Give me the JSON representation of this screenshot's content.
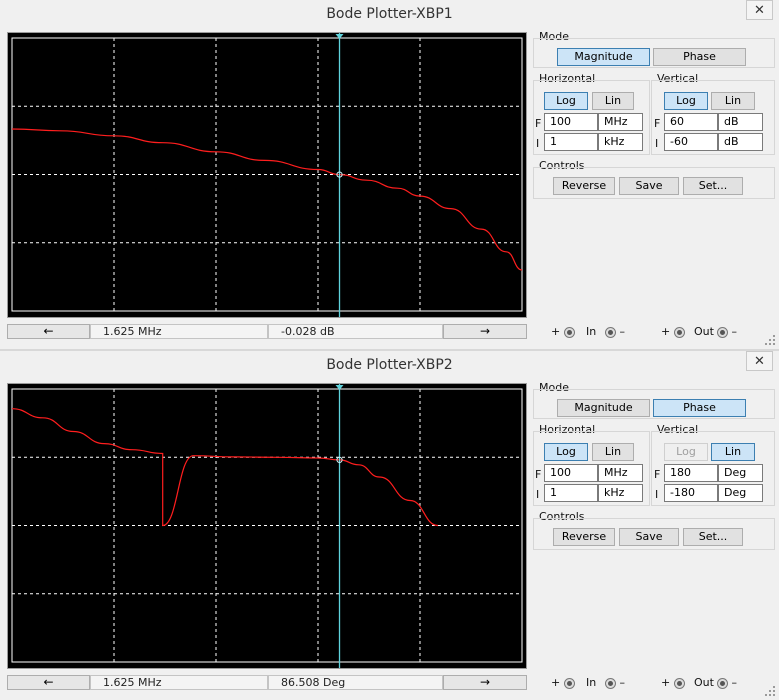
{
  "plotters": [
    {
      "title": "Bode Plotter-XBP1",
      "close_glyph": "✕",
      "mode_label": "Mode",
      "mode_buttons": [
        "Magnitude",
        "Phase"
      ],
      "mode_selected": "Magnitude",
      "horizontal": {
        "label": "Horizontal",
        "scale_buttons": [
          "Log",
          "Lin"
        ],
        "scale_selected": "Log",
        "F": {
          "prefix": "F",
          "value": "100",
          "unit": "MHz"
        },
        "I": {
          "prefix": "I",
          "value": "1",
          "unit": "kHz"
        }
      },
      "vertical": {
        "label": "Vertical",
        "scale_buttons": [
          "Log",
          "Lin"
        ],
        "scale_selected": "Log",
        "log_disabled": false,
        "F": {
          "prefix": "F",
          "value": "60",
          "unit": "dB"
        },
        "I": {
          "prefix": "I",
          "value": "-60",
          "unit": "dB"
        }
      },
      "controls": {
        "label": "Controls",
        "buttons": [
          "Reverse",
          "Save",
          "Set..."
        ]
      },
      "cursor": {
        "left_arrow": "←",
        "right_arrow": "→",
        "frequency": "1.625 MHz",
        "reading": "-0.028 dB"
      },
      "terminals": {
        "in": "In",
        "out": "Out",
        "plus": "+",
        "minus": "–"
      },
      "chart_data": {
        "type": "line",
        "x_scale": "log",
        "x_range_hz": [
          1000,
          100000000
        ],
        "y_range": [
          -60,
          60
        ],
        "y_unit": "dB",
        "cursor_x_hz": 1625000,
        "cursor_y": -0.028,
        "points": [
          [
            1000,
            20
          ],
          [
            3000,
            19.2
          ],
          [
            10000,
            17
          ],
          [
            30000,
            14
          ],
          [
            100000,
            10
          ],
          [
            300000,
            6.2
          ],
          [
            1000000,
            2.2
          ],
          [
            1625000,
            -0.03
          ],
          [
            3000000,
            -2.5
          ],
          [
            6000000,
            -6
          ],
          [
            10000000,
            -9.5
          ],
          [
            20000000,
            -15
          ],
          [
            40000000,
            -24
          ],
          [
            70000000,
            -34
          ],
          [
            100000000,
            -42
          ]
        ],
        "grid": true
      }
    },
    {
      "title": "Bode Plotter-XBP2",
      "close_glyph": "✕",
      "mode_label": "Mode",
      "mode_buttons": [
        "Magnitude",
        "Phase"
      ],
      "mode_selected": "Phase",
      "horizontal": {
        "label": "Horizontal",
        "scale_buttons": [
          "Log",
          "Lin"
        ],
        "scale_selected": "Log",
        "F": {
          "prefix": "F",
          "value": "100",
          "unit": "MHz"
        },
        "I": {
          "prefix": "I",
          "value": "1",
          "unit": "kHz"
        }
      },
      "vertical": {
        "label": "Vertical",
        "scale_buttons": [
          "Log",
          "Lin"
        ],
        "scale_selected": "Lin",
        "log_disabled": true,
        "F": {
          "prefix": "F",
          "value": "180",
          "unit": "Deg"
        },
        "I": {
          "prefix": "I",
          "value": "-180",
          "unit": "Deg"
        }
      },
      "controls": {
        "label": "Controls",
        "buttons": [
          "Reverse",
          "Save",
          "Set..."
        ]
      },
      "cursor": {
        "left_arrow": "←",
        "right_arrow": "→",
        "frequency": "1.625 MHz",
        "reading": "86.508 Deg"
      },
      "terminals": {
        "in": "In",
        "out": "Out",
        "plus": "+",
        "minus": "–"
      },
      "chart_data": {
        "type": "line",
        "x_scale": "log",
        "x_range_hz": [
          1000,
          100000000
        ],
        "y_range": [
          -180,
          180
        ],
        "y_unit": "Deg",
        "cursor_x_hz": 1625000,
        "cursor_y": 86.508,
        "points": [
          [
            1000,
            154
          ],
          [
            2000,
            142
          ],
          [
            4000,
            124
          ],
          [
            8000,
            108
          ],
          [
            15000,
            100
          ],
          [
            30000,
            95
          ],
          [
            60000,
            92
          ],
          [
            150000,
            90.5
          ],
          [
            400000,
            90
          ],
          [
            1000000,
            89
          ],
          [
            1625000,
            86.5
          ],
          [
            2500000,
            80
          ],
          [
            4000000,
            64
          ],
          [
            8000000,
            33
          ],
          [
            15000000,
            0
          ],
          [
            30000,
            0
          ]
        ],
        "grid": true
      }
    }
  ]
}
